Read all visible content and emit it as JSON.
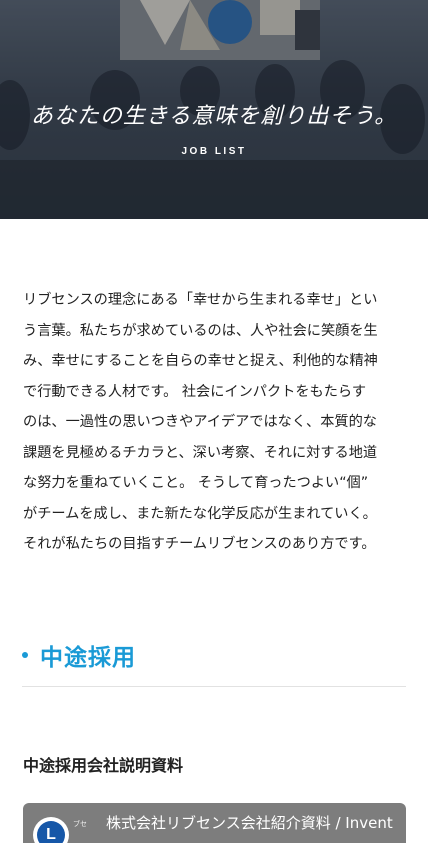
{
  "hero": {
    "tagline": "あなたの生きる意味を創り出そう。",
    "label": "JOB LIST"
  },
  "intro": {
    "lines": [
      "リブセンスの理念にある「幸せから生まれる幸せ」とい",
      "う言葉。私たちが求めているのは、人や社会に笑顔を生",
      "み、幸せにすることを自らの幸せと捉え、利他的な精神",
      "で行動できる人材です。 社会にインパクトをもたらす",
      "のは、一過性の思いつきやアイデアではなく、本質的な",
      "課題を見極めるチカラと、深い考察、それに対する地道",
      "な努力を重ねていくこと。 そうして育ったつよい“個”",
      "がチームを成し、また新たな化学反応が生まれていく。",
      "それが私たちの目指すチームリブセンスのあり方です。"
    ]
  },
  "section": {
    "title": "中途採用",
    "accent_color": "#1a9ad6"
  },
  "materials": {
    "heading": "中途採用会社説明資料",
    "card": {
      "small_label": "ブセ",
      "title": "株式会社リブセンス会社紹介資料 / Invent"
    }
  }
}
